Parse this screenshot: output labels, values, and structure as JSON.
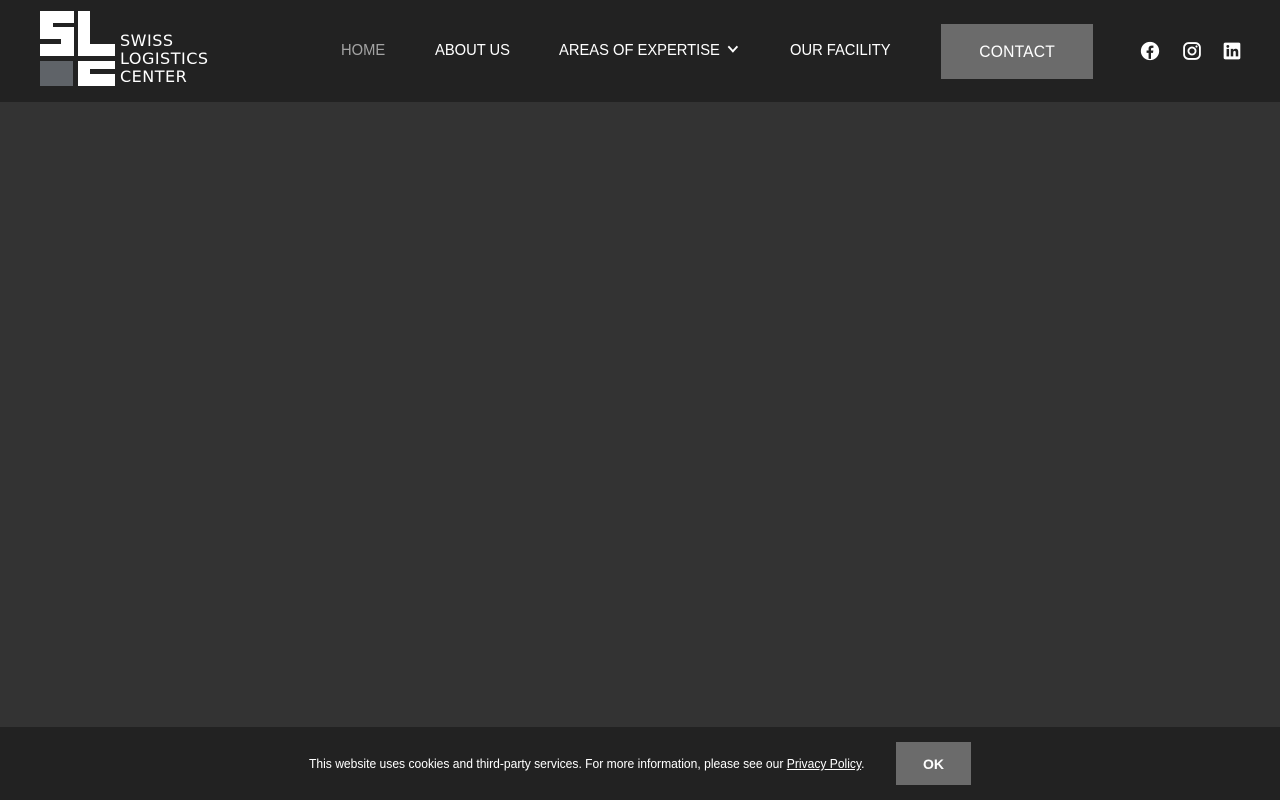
{
  "header": {
    "logo": {
      "mark": "SLC",
      "line1": "SWISS",
      "line2": "LOGISTICS",
      "line3": "CENTER"
    },
    "nav": [
      {
        "label": "HOME",
        "active": true
      },
      {
        "label": "ABOUT US",
        "active": false
      },
      {
        "label": "AREAS OF EXPERTISE",
        "active": false,
        "has_dropdown": true
      },
      {
        "label": "OUR FACILITY",
        "active": false
      }
    ],
    "contact_label": "CONTACT",
    "social": [
      {
        "icon": "facebook-icon"
      },
      {
        "icon": "instagram-icon"
      },
      {
        "icon": "linkedin-icon"
      }
    ]
  },
  "cookie": {
    "text": "This website uses cookies and third-party services. For more information, please see our ",
    "link": "Privacy Policy",
    "suffix": ".",
    "ok_label": "OK"
  },
  "colors": {
    "header_bg": "#222222",
    "page_bg": "#333333",
    "button_bg": "#6b6b6b",
    "active_nav": "#a3a3a3",
    "logo_grey_block": "#5f6368"
  }
}
